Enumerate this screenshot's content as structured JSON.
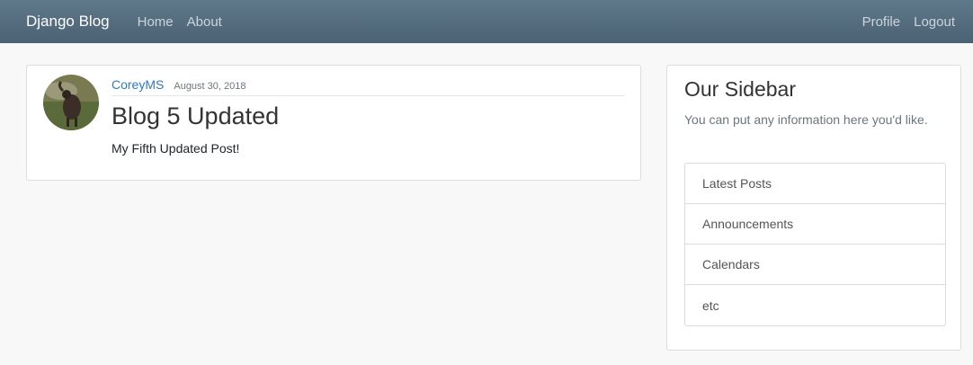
{
  "navbar": {
    "brand": "Django Blog",
    "left_links": [
      "Home",
      "About"
    ],
    "right_links": [
      "Profile",
      "Logout"
    ]
  },
  "post": {
    "author": "CoreyMS",
    "date": "August 30, 2018",
    "title": "Blog 5 Updated",
    "content": "My Fifth Updated Post!"
  },
  "sidebar": {
    "title": "Our Sidebar",
    "text": "You can put any information here you'd like.",
    "items": [
      "Latest Posts",
      "Announcements",
      "Calendars",
      "etc"
    ]
  },
  "colors": {
    "navbar": "#5f788a",
    "link": "#2f78c4",
    "background": "#f8f8f8"
  }
}
